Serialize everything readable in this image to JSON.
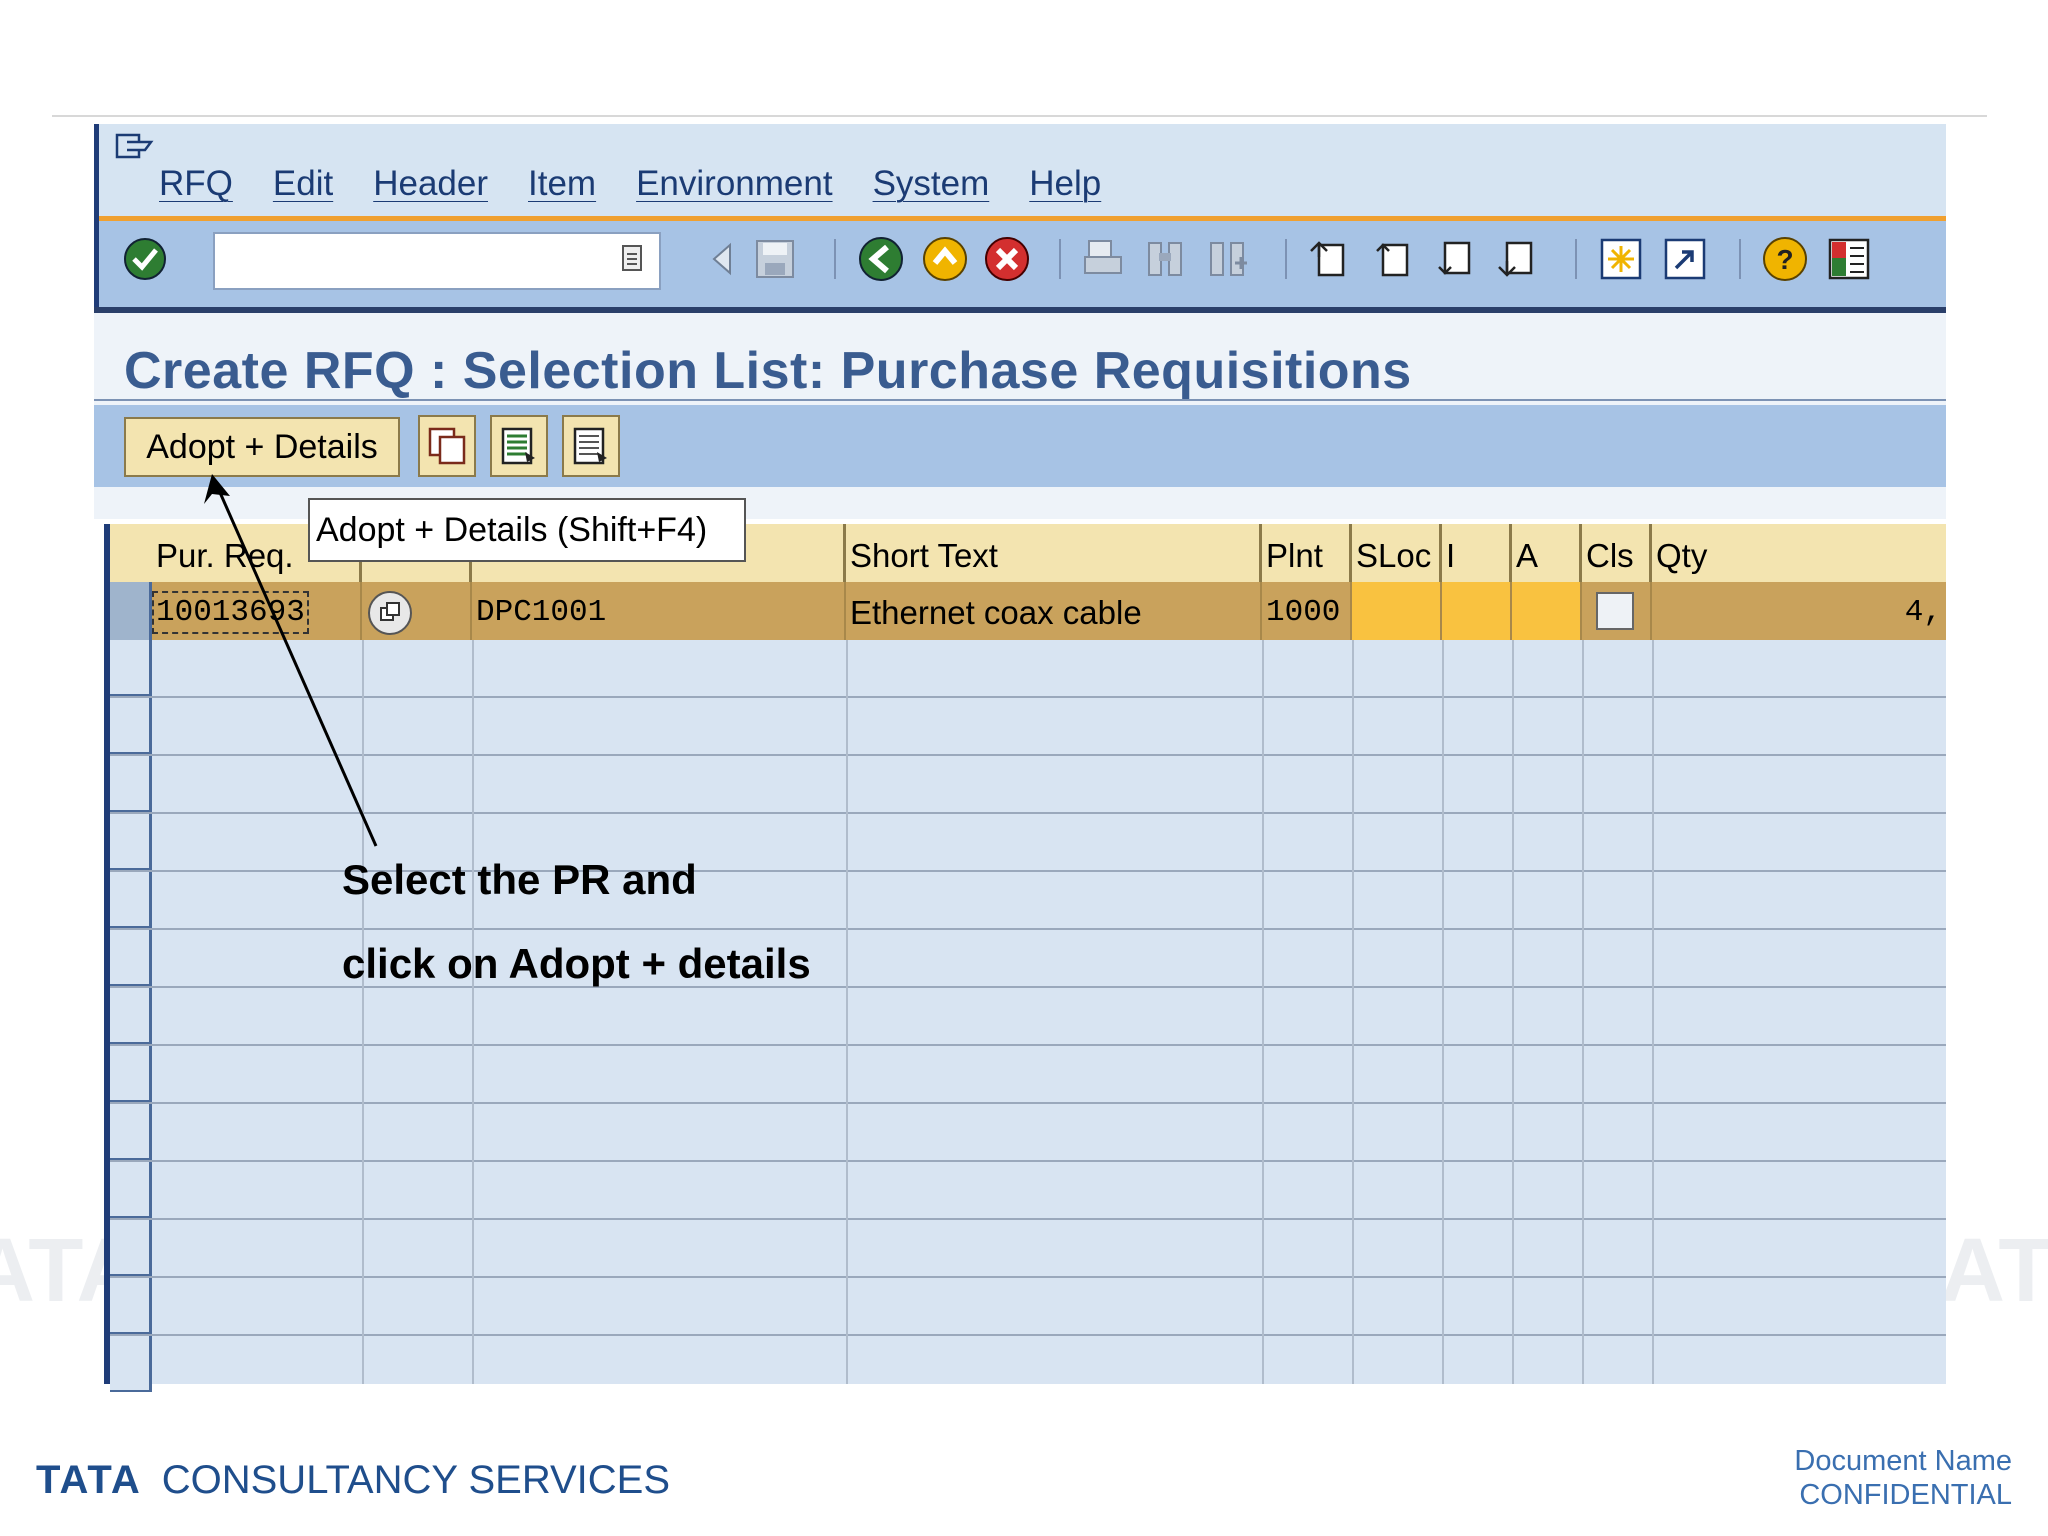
{
  "menubar": {
    "items": [
      "RFQ",
      "Edit",
      "Header",
      "Item",
      "Environment",
      "System",
      "Help"
    ]
  },
  "toolbar": {
    "command_field_value": "",
    "icons": [
      "enter-icon",
      "back-nav-icon",
      "save-icon",
      "back-icon",
      "exit-icon",
      "cancel-icon",
      "print-icon",
      "find-icon",
      "find-next-icon",
      "first-page-icon",
      "previous-page-icon",
      "next-page-icon",
      "last-page-icon",
      "create-session-icon",
      "shortcut-icon",
      "help-icon",
      "customize-layout-icon"
    ]
  },
  "page": {
    "title": "Create RFQ : Selection List: Purchase Requisitions"
  },
  "appbar": {
    "adopt_label": "Adopt + Details"
  },
  "tooltip": {
    "text": "Adopt + Details    (Shift+F4)"
  },
  "table": {
    "headers": [
      "Pur. Req.",
      "",
      "",
      "Short Text",
      "Plnt",
      "SLoc",
      "I",
      "A",
      "Cls",
      "Qty"
    ],
    "rows": [
      {
        "pur_req": "10013693",
        "material": "DPC1001",
        "short_text": "Ethernet coax cable",
        "plant": "1000",
        "sloc": "",
        "i": "",
        "a": "",
        "cls_checked": false,
        "qty": "4,"
      }
    ]
  },
  "annotation": {
    "line1": "Select the PR and",
    "line2": "click on Adopt + details"
  },
  "footer": {
    "logo_tata": "TATA",
    "logo_text": "CONSULTANCY SERVICES",
    "doc_name": "Document Name",
    "confidential": "CONFIDENTIAL"
  }
}
